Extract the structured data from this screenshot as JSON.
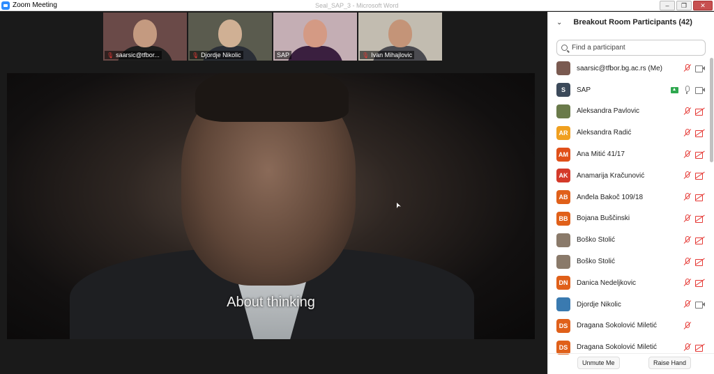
{
  "window": {
    "title": "Zoom Meeting",
    "ghost_title": "Seal_SAP_3 - Microsoft Word"
  },
  "thumbnails": [
    {
      "name": "saarsic@tfbor...",
      "muted": true,
      "bg": "#6a4a48",
      "skin": "#c49a80",
      "cloth": "#1e1e1e"
    },
    {
      "name": "Djordje Nikolic",
      "muted": true,
      "bg": "#5a5b4e",
      "skin": "#d0b094",
      "cloth": "#2a2e36"
    },
    {
      "name": "SAP",
      "muted": false,
      "bg": "#c4aeb4",
      "skin": "#d49a84",
      "cloth": "#3a1f3f",
      "active": true
    },
    {
      "name": "Ivan Mihajlovic",
      "muted": true,
      "bg": "#c2bcb0",
      "skin": "#c49478",
      "cloth": "#4a4a50"
    }
  ],
  "video": {
    "subtitle": "About thinking"
  },
  "panel": {
    "title": "Breakout Room Participants (42)",
    "search_placeholder": "Find a participant",
    "participants": [
      {
        "initials": "",
        "avatar_color": "#7a5a50",
        "photo": true,
        "name": "saarsic@tfbor.bg.ac.rs (Me)",
        "mic": "muted",
        "cam": "on"
      },
      {
        "initials": "S",
        "avatar_color": "#3c4a5a",
        "name": "SAP",
        "share": true,
        "mic": "on",
        "cam": "on"
      },
      {
        "initials": "",
        "avatar_color": "#6a7a4a",
        "photo": true,
        "name": "Aleksandra Pavlovic",
        "mic": "muted",
        "cam": "off"
      },
      {
        "initials": "AR",
        "avatar_color": "#f0a020",
        "name": "Aleksandra Radić",
        "mic": "muted",
        "cam": "off"
      },
      {
        "initials": "AM",
        "avatar_color": "#e0501a",
        "name": "Ana Mitić 41/17",
        "mic": "muted",
        "cam": "off"
      },
      {
        "initials": "AK",
        "avatar_color": "#d43a2a",
        "name": "Anamarija Kračunović",
        "mic": "muted",
        "cam": "off"
      },
      {
        "initials": "AB",
        "avatar_color": "#e0601a",
        "name": "Anđela Bakoč 109/18",
        "mic": "muted",
        "cam": "off"
      },
      {
        "initials": "BB",
        "avatar_color": "#e0601a",
        "name": "Bojana Buščinski",
        "mic": "muted",
        "cam": "off"
      },
      {
        "initials": "",
        "avatar_color": "#8a7a6a",
        "photo": true,
        "name": "Boško Stolić",
        "mic": "muted",
        "cam": "off"
      },
      {
        "initials": "",
        "avatar_color": "#8a7a6a",
        "photo": true,
        "name": "Boško Stolić",
        "mic": "muted",
        "cam": "off"
      },
      {
        "initials": "DN",
        "avatar_color": "#e0601a",
        "name": "Danica Nedeljkovic",
        "mic": "muted",
        "cam": "off"
      },
      {
        "initials": "",
        "avatar_color": "#3a7ab0",
        "photo": true,
        "name": "Djordje Nikolic",
        "mic": "muted",
        "cam": "on"
      },
      {
        "initials": "DS",
        "avatar_color": "#e0601a",
        "name": "Dragana Sokolović Miletić",
        "mic": "muted",
        "cam": "none"
      },
      {
        "initials": "DS",
        "avatar_color": "#e0601a",
        "name": "Dragana Sokolović Miletić",
        "mic": "muted",
        "cam": "off"
      }
    ],
    "footer": {
      "unmute_label": "Unmute Me",
      "raise_label": "Raise Hand"
    }
  }
}
